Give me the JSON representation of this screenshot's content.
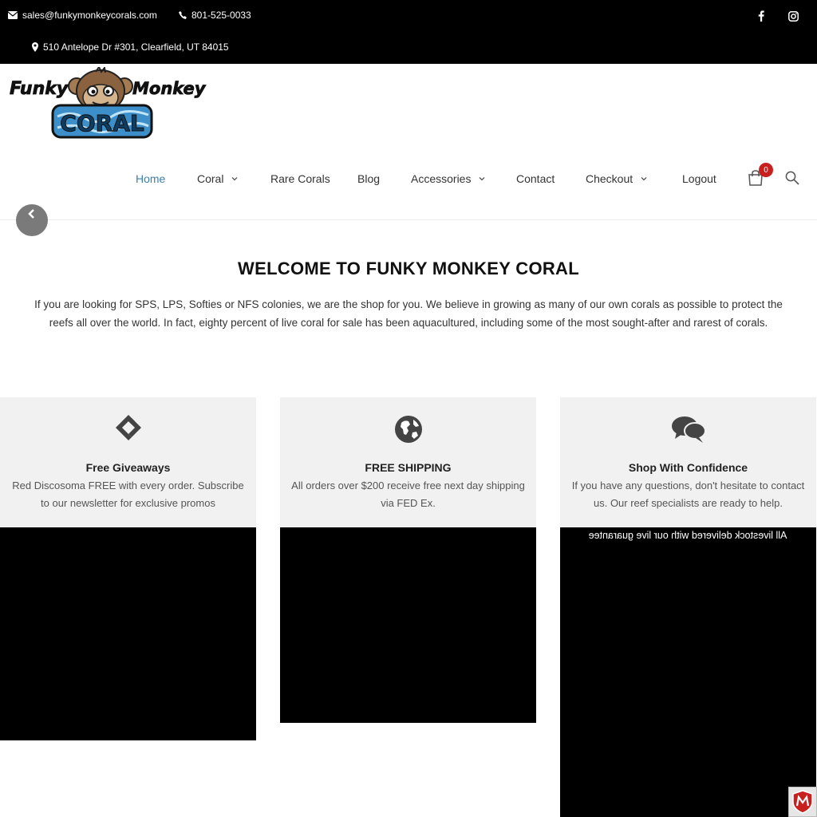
{
  "topbar": {
    "email": "sales@funkymonkeycorals.com",
    "phone": "801-525-0033",
    "address": "510 Antelope Dr #301, Clearfield, UT 84015",
    "social": [
      "facebook-icon",
      "instagram-icon"
    ]
  },
  "logo": {
    "line1_left": "Funky",
    "line1_right": "Monkey",
    "line2": "CORAL"
  },
  "nav": {
    "items": [
      {
        "label": "Home",
        "active": true,
        "dropdown": false
      },
      {
        "label": "Coral",
        "active": false,
        "dropdown": true
      },
      {
        "label": "Rare Corals",
        "active": false,
        "dropdown": false
      },
      {
        "label": "Blog",
        "active": false,
        "dropdown": false
      },
      {
        "label": "Accessories",
        "active": false,
        "dropdown": true
      },
      {
        "label": "Contact",
        "active": false,
        "dropdown": false
      },
      {
        "label": "Checkout",
        "active": false,
        "dropdown": true
      },
      {
        "label": "Logout",
        "active": false,
        "dropdown": false
      }
    ],
    "cart_count": "0"
  },
  "welcome": {
    "title": "WELCOME TO FUNKY MONKEY CORAL",
    "text": "If you are looking for SPS, LPS, Softies or NFS colonies, we are the shop for you. We believe in growing as many of our own corals as possible to protect the reefs all over the world. In fact, eighty percent of live coral for sale has been aquacultured, including some of the most sought-after and rarest of corals."
  },
  "features": [
    {
      "icon": "link-diamond-icon",
      "title": "Free Giveaways",
      "desc": "Red Discosoma FREE with every order. Subscribe to our newsletter for exclusive promos"
    },
    {
      "icon": "globe-icon",
      "title": "FREE SHIPPING",
      "desc": "All orders over $200 receive free next day shipping via FED Ex."
    },
    {
      "icon": "chat-bubbles-icon",
      "title": "Shop With Confidence",
      "desc": "If you have any questions, don't hesitate to contact us. Our reef specialists are ready to help."
    }
  ],
  "mirrored_caption": "All livestock delivered with our live guarantee",
  "colors": {
    "topbar_bg": "#000000",
    "nav_active": "#3a7fb5",
    "cart_badge": "#c8201e",
    "card_bg": "#f1f1f1"
  }
}
